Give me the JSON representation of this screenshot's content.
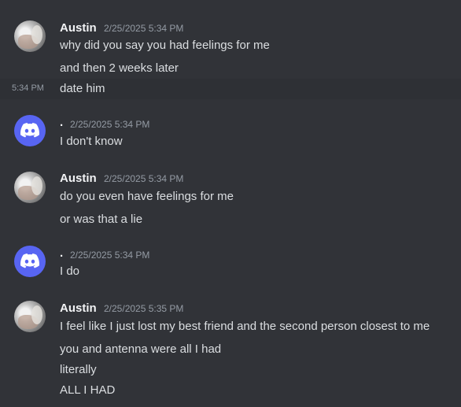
{
  "groups": [
    {
      "author": "Austin",
      "timestamp": "2/25/2025 5:34 PM",
      "avatar_icon": "user-photo-avatar",
      "messages": [
        "why did you say you had feelings for me",
        "and then 2 weeks later",
        "date him"
      ]
    },
    {
      "author": ".",
      "timestamp": "2/25/2025 5:34 PM",
      "avatar_icon": "discord-logo-avatar",
      "messages": [
        "I don't know"
      ]
    },
    {
      "author": "Austin",
      "timestamp": "2/25/2025 5:34 PM",
      "avatar_icon": "user-photo-avatar",
      "messages": [
        "do you even have feelings for me",
        "or was that a lie"
      ]
    },
    {
      "author": ".",
      "timestamp": "2/25/2025 5:34 PM",
      "avatar_icon": "discord-logo-avatar",
      "messages": [
        "I do"
      ]
    },
    {
      "author": "Austin",
      "timestamp": "2/25/2025 5:35 PM",
      "avatar_icon": "user-photo-avatar",
      "messages": [
        "I feel like I just lost my best friend and the second person closest to me",
        "you and antenna were all I had",
        "literally",
        "ALL I HAD"
      ]
    }
  ],
  "hover_timestamp": "5:34 PM",
  "colors": {
    "background": "#313338",
    "hover_row": "#2e3035",
    "blurple": "#5865f2",
    "text": "#dbdee1",
    "author": "#f2f3f5",
    "timestamp": "#949ba4"
  }
}
